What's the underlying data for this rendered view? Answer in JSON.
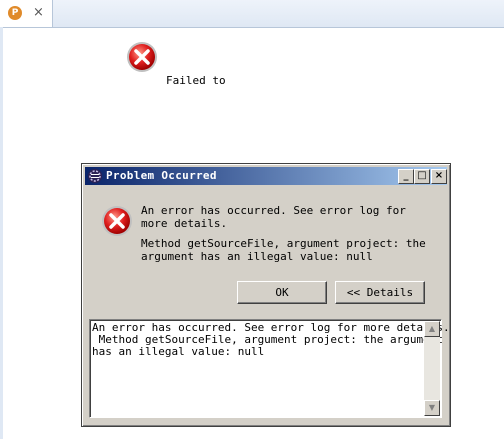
{
  "editor": {
    "tab_icon_letter": "P",
    "tab_close": "×",
    "message": "Failed to"
  },
  "dialog": {
    "title": "Problem Occurred",
    "window_buttons": {
      "minimize": "_",
      "maximize": "□",
      "close": "×"
    },
    "message_line1": "An error has occurred. See error log for more details.",
    "message_line2": "Method getSourceFile, argument project: the argument has an illegal value: null",
    "ok_label": "OK",
    "details_label": "<< Details",
    "details_text": "An error has occurred. See error log for more details.\n Method getSourceFile, argument project: the argument\nhas an illegal value: null",
    "scroll_up": "▲",
    "scroll_down": "▼"
  },
  "colors": {
    "title_bar_start": "#0a246a",
    "title_bar_end": "#a6caf0",
    "dialog_bg": "#d4d0c8",
    "error_red": "#d42020"
  },
  "icons": [
    "error-icon",
    "eclipse-icon",
    "close-icon",
    "minimize-icon",
    "maximize-icon"
  ]
}
